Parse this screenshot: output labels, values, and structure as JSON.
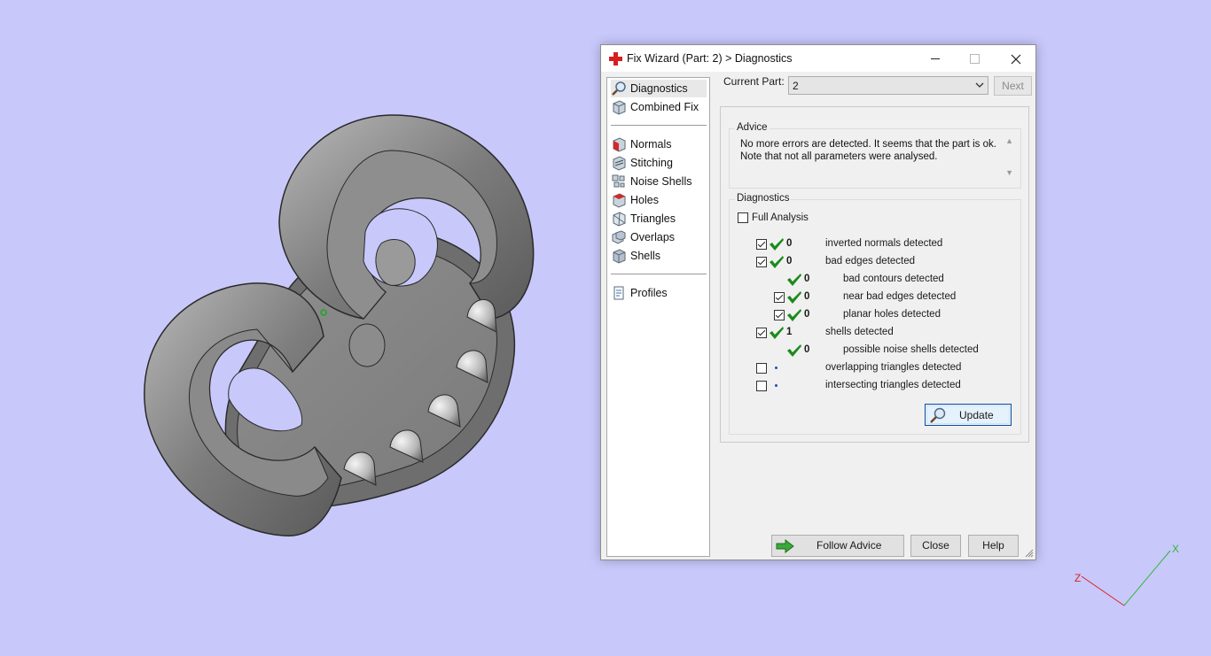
{
  "window": {
    "title": "Fix Wizard (Part: 2) > Diagnostics",
    "title_icon": "red-cross-icon"
  },
  "nav": {
    "items": [
      {
        "label": "Diagnostics",
        "icon": "magnifier-icon"
      },
      {
        "label": "Combined Fix",
        "icon": "cube-icon"
      },
      {
        "label": "Normals",
        "icon": "normals-cube-icon"
      },
      {
        "label": "Stitching",
        "icon": "stitching-cube-icon"
      },
      {
        "label": "Noise Shells",
        "icon": "noise-shells-icon"
      },
      {
        "label": "Holes",
        "icon": "holes-cube-icon"
      },
      {
        "label": "Triangles",
        "icon": "triangles-icon"
      },
      {
        "label": "Overlaps",
        "icon": "overlaps-icon"
      },
      {
        "label": "Shells",
        "icon": "shells-icon"
      },
      {
        "label": "Profiles",
        "icon": "profiles-icon"
      }
    ],
    "selected": "Diagnostics"
  },
  "toolbar": {
    "current_part_label": "Current Part:",
    "current_part_value": "2",
    "next_label": "Next"
  },
  "advice": {
    "title": "Advice",
    "line1": "No more errors are detected. It seems that the part is ok.",
    "line2": "Note that not all parameters were analysed."
  },
  "diagnostics": {
    "title": "Diagnostics",
    "full_analysis_label": "Full Analysis",
    "full_analysis_checked": false,
    "rows": [
      {
        "checkbox": true,
        "status": "ok",
        "count": "0",
        "text": "inverted normals detected"
      },
      {
        "checkbox": true,
        "status": "ok",
        "count": "0",
        "text": "bad edges detected"
      },
      {
        "checkbox": null,
        "status": "ok",
        "count": "0",
        "text": "bad contours detected"
      },
      {
        "checkbox": true,
        "status": "ok",
        "count": "0",
        "text": "near bad edges detected"
      },
      {
        "checkbox": true,
        "status": "ok",
        "count": "0",
        "text": "planar holes detected"
      },
      {
        "checkbox": true,
        "status": "ok",
        "count": "1",
        "text": "shells detected"
      },
      {
        "checkbox": null,
        "status": "ok",
        "count": "0",
        "text": "possible noise shells detected"
      },
      {
        "checkbox": false,
        "status": "not-analysed",
        "count": "",
        "text": "overlapping triangles detected"
      },
      {
        "checkbox": false,
        "status": "not-analysed",
        "count": "",
        "text": "intersecting triangles detected"
      }
    ],
    "update_label": "Update"
  },
  "footer": {
    "follow_advice_label": "Follow Advice",
    "close_label": "Close",
    "help_label": "Help"
  },
  "axes": {
    "x_label": "X",
    "z_label": "Z",
    "x_color": "#2eb82e",
    "z_color": "#e02020"
  },
  "colors": {
    "background": "#c8c8fb",
    "check_green": "#1a8a1a",
    "accent_blue": "#0b4da2"
  }
}
